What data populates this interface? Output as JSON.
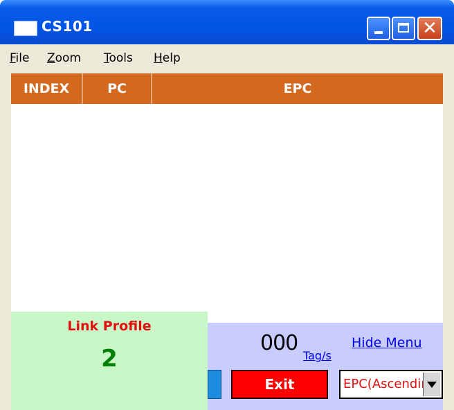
{
  "window": {
    "title": "CS101",
    "icons": {
      "app": "window-icon",
      "minimize": "minimize-icon",
      "maximize": "maximize-icon",
      "close": "close-icon"
    },
    "close_glyph": "✕"
  },
  "menu": {
    "items": [
      {
        "accel": "F",
        "rest": "ile"
      },
      {
        "accel": "Z",
        "rest": "oom"
      },
      {
        "accel": "T",
        "rest": "ools"
      },
      {
        "accel": "H",
        "rest": "elp"
      }
    ]
  },
  "table": {
    "columns": [
      "INDEX",
      "PC",
      "EPC"
    ],
    "rows": [],
    "header_color": "#D2691E"
  },
  "link_profile": {
    "title": "Link Profile",
    "value": "2"
  },
  "status": {
    "rate_value": "000",
    "rate_unit": "Tag/s",
    "hide_menu": "Hide Menu"
  },
  "controls": {
    "exit_label": "Exit",
    "sort_selected": "EPC(Ascending)",
    "sort_arrow_icon": "chevron-down-icon"
  },
  "colors": {
    "titlebar": "#0055E5",
    "bottom_panel": "#C8CCFF",
    "link_panel": "#C8F8C8",
    "exit_button": "#FF0000",
    "link_value": "#008000",
    "link_title": "#E01010"
  }
}
